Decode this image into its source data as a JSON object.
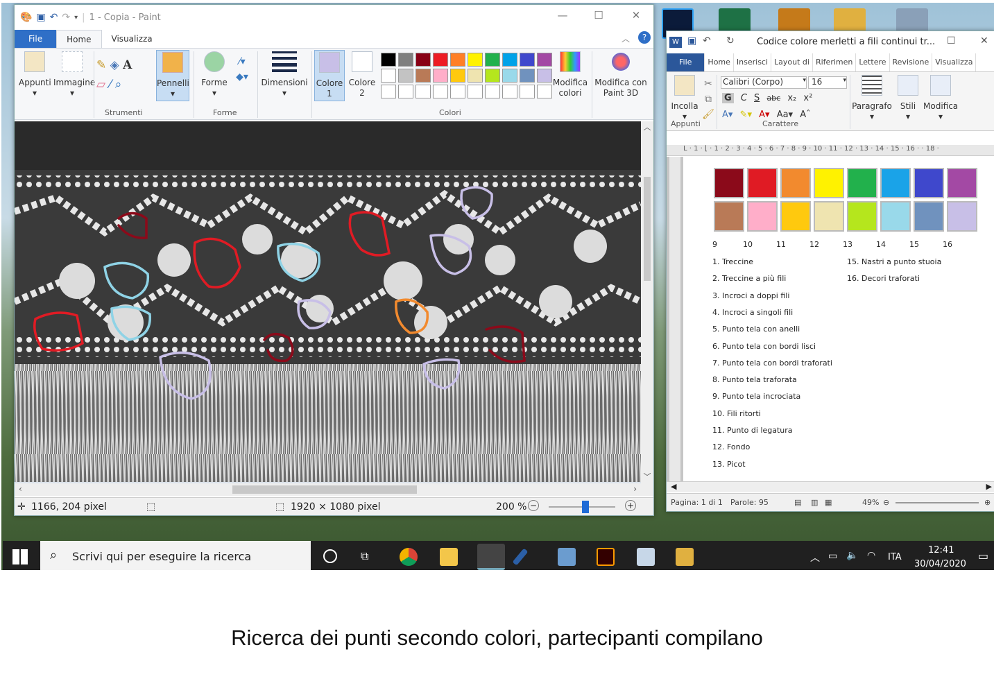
{
  "paint": {
    "title": "1 - Copia - Paint",
    "tabs": {
      "file": "File",
      "home": "Home",
      "view": "Visualizza"
    },
    "ribbon": {
      "clipboard": "Appunti",
      "image": "Immagine",
      "tools_group": "Strumenti",
      "brushes": "Pennelli",
      "shapes": "Forme",
      "shapes_group": "Forme",
      "size": "Dimensioni",
      "color1_l1": "Colore",
      "color1_l2": "1",
      "color2_l1": "Colore",
      "color2_l2": "2",
      "colors_group": "Colori",
      "edit_colors_l1": "Modifica",
      "edit_colors_l2": "colori",
      "paint3d_l1": "Modifica con",
      "paint3d_l2": "Paint 3D"
    },
    "palette_colors": [
      "#000000",
      "#7f7f7f",
      "#880015",
      "#ed1c24",
      "#ff7f27",
      "#fff200",
      "#22b14c",
      "#00a2e8",
      "#3f48cc",
      "#a349a4",
      "#ffffff",
      "#c3c3c3",
      "#b97a57",
      "#ffaec9",
      "#ffc90e",
      "#efe4b0",
      "#b5e61d",
      "#99d9ea",
      "#7092be",
      "#c8bfe7",
      "#ffffff",
      "#ffffff",
      "#ffffff",
      "#ffffff",
      "#ffffff",
      "#ffffff",
      "#ffffff",
      "#ffffff",
      "#ffffff",
      "#ffffff"
    ],
    "status": {
      "cursor": "1166, 204 pixel",
      "size": "1920 × 1080 pixel",
      "zoom": "200 %"
    },
    "markers": [
      {
        "color": "#8b0a1a"
      },
      {
        "color": "#e01b24"
      },
      {
        "color": "#8fd3e6"
      },
      {
        "color": "#c8bfe7"
      },
      {
        "color": "#f28a2e"
      }
    ]
  },
  "word": {
    "title": "Codice colore merletti a fili continui  tr...",
    "tabs": [
      "File",
      "Home",
      "Inserisci",
      "Layout di",
      "Riferimen",
      "Lettere",
      "Revisione",
      "Visualizza"
    ],
    "ribbon": {
      "paste": "Incolla",
      "clipboard_group": "Appunti",
      "font_name": "Calibri (Corpo)",
      "font_size": "16",
      "font_group": "Carattere",
      "paragraph": "Paragrafo",
      "styles": "Stili",
      "edit": "Modifica"
    },
    "ruler": "L  · 1 · ⌊ · 1 · 2 · 3 · 4 · 5 · 6 · 7 · 8 · 9 · 10 · 11 · 12 · 13 · 14 · 15 · 16 ·  · 18 ·",
    "swatch_colors": [
      "#8b0a1a",
      "#e01b24",
      "#f28a2e",
      "#fff200",
      "#22b14c",
      "#1aa3e8",
      "#3f48cc",
      "#a349a4",
      "#b97a57",
      "#ffaec9",
      "#ffc90e",
      "#efe4b0",
      "#b5e61d",
      "#99d9ea",
      "#7092be",
      "#c8bfe7"
    ],
    "swatch_numbers": [
      "9",
      "10",
      "11",
      "12",
      "13",
      "14",
      "15",
      "16"
    ],
    "list_left": [
      "1. Treccine",
      "2. Treccine a più fili",
      "3. Incroci a doppi fili",
      "4. Incroci a singoli fili",
      "5. Punto tela con anelli",
      "6. Punto tela con bordi lisci",
      "7. Punto tela con bordi traforati",
      "8. Punto tela traforata",
      "9. Punto tela incrociata",
      "10. Fili ritorti",
      "11. Punto di legatura",
      "12. Fondo",
      "13. Picot"
    ],
    "list_right": [
      "15. Nastri a punto stuoia",
      "16. Decori traforati"
    ],
    "status": {
      "page": "Pagina: 1 di 1",
      "words": "Parole: 95",
      "zoom": "49%"
    }
  },
  "taskbar": {
    "search_placeholder": "Scrivi qui per eseguire la ricerca",
    "lang": "ITA",
    "time": "12:41",
    "date": "30/04/2020"
  },
  "caption": "Ricerca dei punti secondo colori, partecipanti compilano"
}
